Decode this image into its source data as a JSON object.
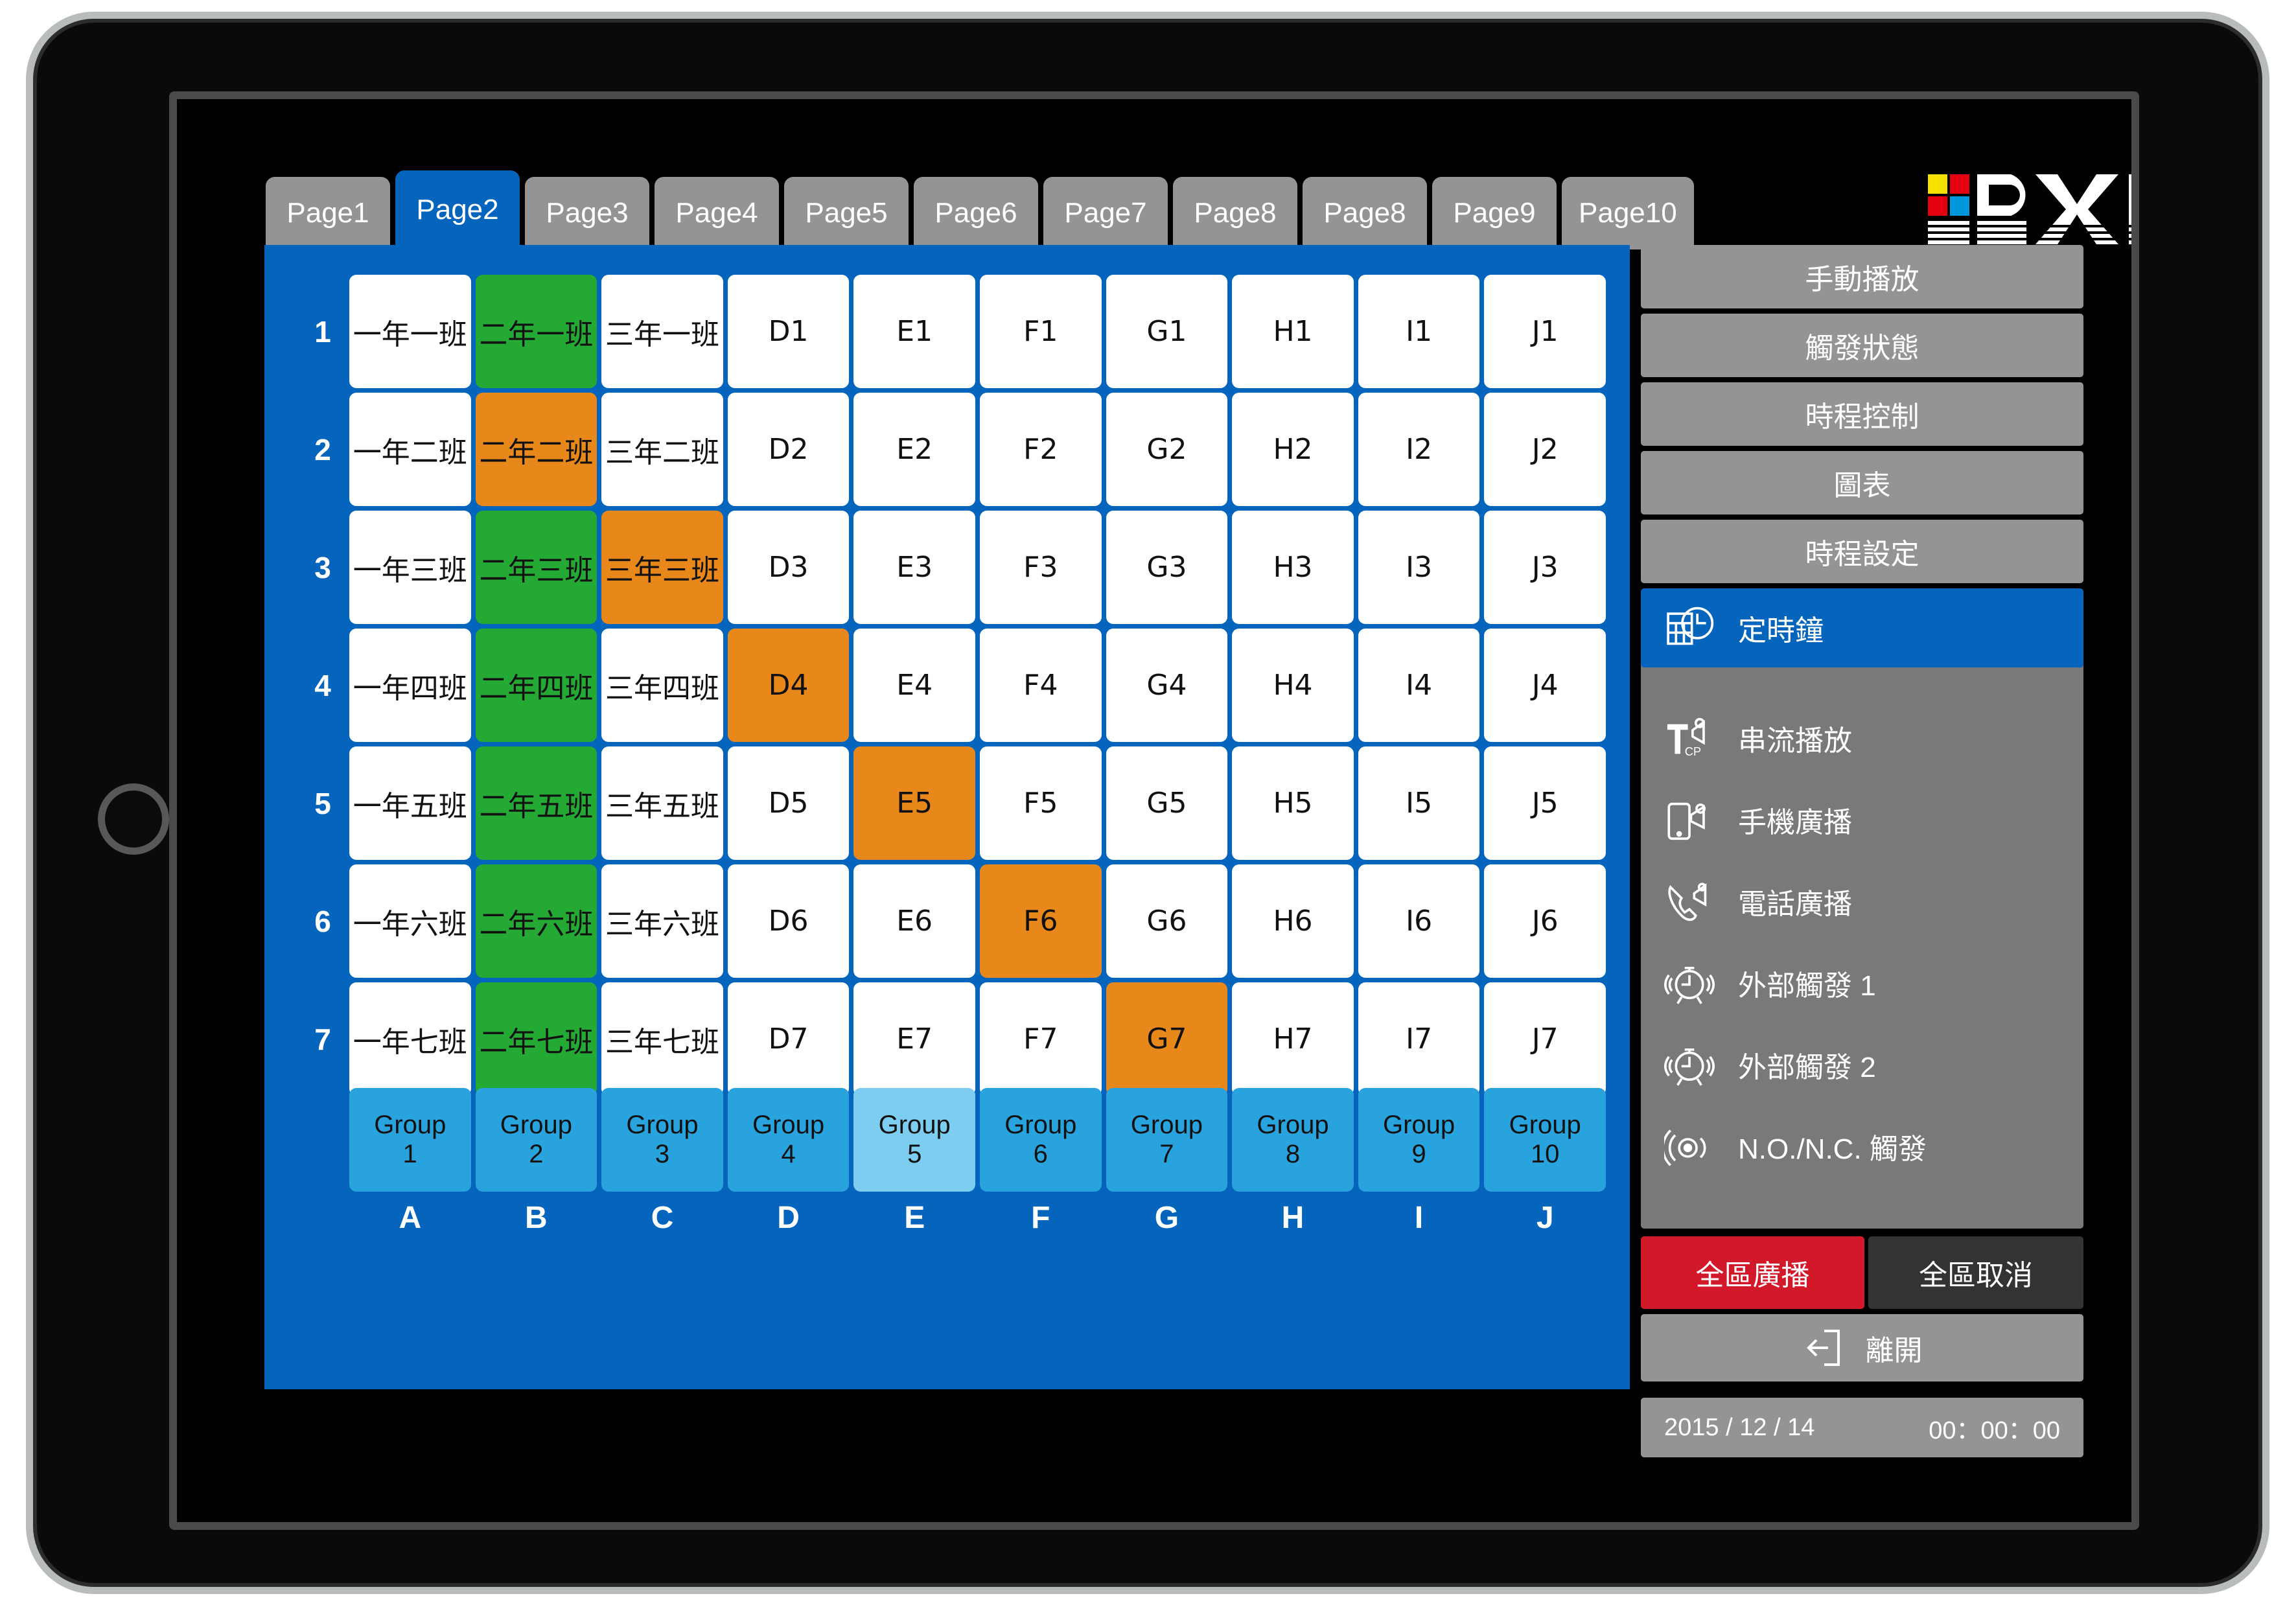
{
  "tabs": [
    {
      "label": "Page1",
      "active": false
    },
    {
      "label": "Page2",
      "active": true
    },
    {
      "label": "Page3",
      "active": false
    },
    {
      "label": "Page4",
      "active": false
    },
    {
      "label": "Page5",
      "active": false
    },
    {
      "label": "Page6",
      "active": false
    },
    {
      "label": "Page7",
      "active": false
    },
    {
      "label": "Page8",
      "active": false
    },
    {
      "label": "Page8",
      "active": false
    },
    {
      "label": "Page9",
      "active": false
    },
    {
      "label": "Page10",
      "active": false
    }
  ],
  "matrix": {
    "row_numbers": [
      "1",
      "2",
      "3",
      "4",
      "5",
      "6",
      "7"
    ],
    "column_letters": [
      "A",
      "B",
      "C",
      "D",
      "E",
      "F",
      "G",
      "H",
      "I",
      "J"
    ],
    "rows": [
      [
        {
          "label": "一年一班",
          "state": "idle"
        },
        {
          "label": "二年一班",
          "state": "green"
        },
        {
          "label": "三年一班",
          "state": "idle"
        },
        {
          "label": "D1",
          "state": "idle"
        },
        {
          "label": "E1",
          "state": "idle"
        },
        {
          "label": "F1",
          "state": "idle"
        },
        {
          "label": "G1",
          "state": "idle"
        },
        {
          "label": "H1",
          "state": "idle"
        },
        {
          "label": "I1",
          "state": "idle"
        },
        {
          "label": "J1",
          "state": "idle"
        }
      ],
      [
        {
          "label": "一年二班",
          "state": "idle"
        },
        {
          "label": "二年二班",
          "state": "orange"
        },
        {
          "label": "三年二班",
          "state": "idle"
        },
        {
          "label": "D2",
          "state": "idle"
        },
        {
          "label": "E2",
          "state": "idle"
        },
        {
          "label": "F2",
          "state": "idle"
        },
        {
          "label": "G2",
          "state": "idle"
        },
        {
          "label": "H2",
          "state": "idle"
        },
        {
          "label": "I2",
          "state": "idle"
        },
        {
          "label": "J2",
          "state": "idle"
        }
      ],
      [
        {
          "label": "一年三班",
          "state": "idle"
        },
        {
          "label": "二年三班",
          "state": "green"
        },
        {
          "label": "三年三班",
          "state": "orange"
        },
        {
          "label": "D3",
          "state": "idle"
        },
        {
          "label": "E3",
          "state": "idle"
        },
        {
          "label": "F3",
          "state": "idle"
        },
        {
          "label": "G3",
          "state": "idle"
        },
        {
          "label": "H3",
          "state": "idle"
        },
        {
          "label": "I3",
          "state": "idle"
        },
        {
          "label": "J3",
          "state": "idle"
        }
      ],
      [
        {
          "label": "一年四班",
          "state": "idle"
        },
        {
          "label": "二年四班",
          "state": "green"
        },
        {
          "label": "三年四班",
          "state": "idle"
        },
        {
          "label": "D4",
          "state": "orange"
        },
        {
          "label": "E4",
          "state": "idle"
        },
        {
          "label": "F4",
          "state": "idle"
        },
        {
          "label": "G4",
          "state": "idle"
        },
        {
          "label": "H4",
          "state": "idle"
        },
        {
          "label": "I4",
          "state": "idle"
        },
        {
          "label": "J4",
          "state": "idle"
        }
      ],
      [
        {
          "label": "一年五班",
          "state": "idle"
        },
        {
          "label": "二年五班",
          "state": "green"
        },
        {
          "label": "三年五班",
          "state": "idle"
        },
        {
          "label": "D5",
          "state": "idle"
        },
        {
          "label": "E5",
          "state": "orange"
        },
        {
          "label": "F5",
          "state": "idle"
        },
        {
          "label": "G5",
          "state": "idle"
        },
        {
          "label": "H5",
          "state": "idle"
        },
        {
          "label": "I5",
          "state": "idle"
        },
        {
          "label": "J5",
          "state": "idle"
        }
      ],
      [
        {
          "label": "一年六班",
          "state": "idle"
        },
        {
          "label": "二年六班",
          "state": "green"
        },
        {
          "label": "三年六班",
          "state": "idle"
        },
        {
          "label": "D6",
          "state": "idle"
        },
        {
          "label": "E6",
          "state": "idle"
        },
        {
          "label": "F6",
          "state": "orange"
        },
        {
          "label": "G6",
          "state": "idle"
        },
        {
          "label": "H6",
          "state": "idle"
        },
        {
          "label": "I6",
          "state": "idle"
        },
        {
          "label": "J6",
          "state": "idle"
        }
      ],
      [
        {
          "label": "一年七班",
          "state": "idle"
        },
        {
          "label": "二年七班",
          "state": "green"
        },
        {
          "label": "三年七班",
          "state": "idle"
        },
        {
          "label": "D7",
          "state": "idle"
        },
        {
          "label": "E7",
          "state": "idle"
        },
        {
          "label": "F7",
          "state": "idle"
        },
        {
          "label": "G7",
          "state": "orange"
        },
        {
          "label": "H7",
          "state": "idle"
        },
        {
          "label": "I7",
          "state": "idle"
        },
        {
          "label": "J7",
          "state": "idle"
        }
      ]
    ],
    "groups": [
      {
        "title": "Group",
        "number": "1",
        "selected": false
      },
      {
        "title": "Group",
        "number": "2",
        "selected": false
      },
      {
        "title": "Group",
        "number": "3",
        "selected": false
      },
      {
        "title": "Group",
        "number": "4",
        "selected": false
      },
      {
        "title": "Group",
        "number": "5",
        "selected": true
      },
      {
        "title": "Group",
        "number": "6",
        "selected": false
      },
      {
        "title": "Group",
        "number": "7",
        "selected": false
      },
      {
        "title": "Group",
        "number": "8",
        "selected": false
      },
      {
        "title": "Group",
        "number": "9",
        "selected": false
      },
      {
        "title": "Group",
        "number": "10",
        "selected": false
      }
    ]
  },
  "sidebar": {
    "top_buttons": [
      {
        "label": "手動播放"
      },
      {
        "label": "觸發狀態"
      },
      {
        "label": "時程控制"
      },
      {
        "label": "圖表"
      },
      {
        "label": "時程設定"
      }
    ],
    "items": [
      {
        "label": "定時鐘",
        "icon": "schedule-clock-icon",
        "active": true
      },
      {
        "label": "串流播放",
        "icon": "tcp-stream-broadcast-icon",
        "active": false
      },
      {
        "label": "手機廣播",
        "icon": "mobile-broadcast-icon",
        "active": false
      },
      {
        "label": "電話廣播",
        "icon": "phone-broadcast-icon",
        "active": false
      },
      {
        "label": "外部觸發 1",
        "icon": "alarm-trigger-icon",
        "active": false
      },
      {
        "label": "外部觸發 2",
        "icon": "alarm-trigger-icon",
        "active": false
      },
      {
        "label": "N.O./N.C. 觸發",
        "icon": "contact-trigger-icon",
        "active": false
      }
    ],
    "broadcast_all_label": "全區廣播",
    "cancel_all_label": "全區取消",
    "exit_label": "離開",
    "exit_icon": "exit-arrow-icon"
  },
  "status": {
    "date": "2015 / 12 / 14",
    "time": "00：00：00"
  },
  "logo": {
    "name": "BXB",
    "swatch_colors": [
      "#F5E000",
      "#E3000F",
      "#E3000F",
      "#0098DA"
    ]
  },
  "colors": {
    "panel_blue": "#0565BC",
    "active_green": "#25A935",
    "active_orange": "#E8871A",
    "group_blue": "#29A3DE",
    "group_selected_blue": "#7CCDF0",
    "sidebar_gray": "#949494",
    "sidebar_block_gray": "#797979",
    "broadcast_red": "#D2192A",
    "cancel_dark": "#333333"
  }
}
